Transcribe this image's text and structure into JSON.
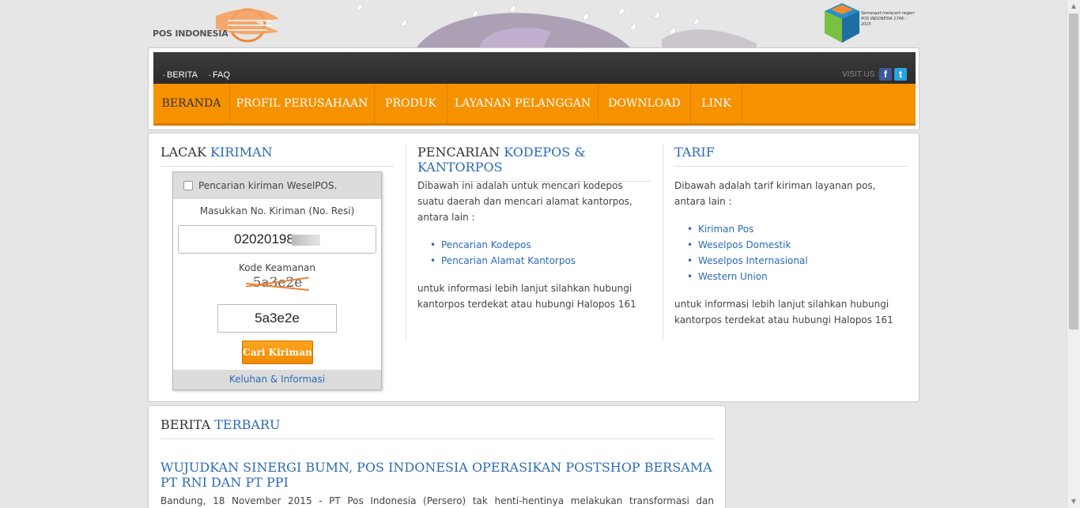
{
  "header": {
    "logo_text": "POS INDONESIA",
    "tagline": "Semangat melayani negeri POS INDONESIA 1746 - 2015"
  },
  "toplinks": {
    "berita": "BERITA",
    "faq": "FAQ",
    "visit_us": "VISIT US :"
  },
  "social": {
    "facebook": "f",
    "twitter": "t"
  },
  "menu": [
    "BERANDA",
    "PROFIL PERUSAHAAN",
    "PRODUK",
    "LAYANAN PELANGGAN",
    "DOWNLOAD",
    "LINK"
  ],
  "lacak": {
    "title_a": "LACAK",
    "title_b": "KIRIMAN",
    "checkbox_label": "Pencarian kiriman WeselPOS.",
    "resi_label": "Masukkan No. Kiriman (No. Resi)",
    "resi_value": "0202019",
    "resi_value_tail": "8",
    "kode_label": "Kode Keamanan",
    "captcha_image_text": "5a3e2e",
    "captcha_value": "5a3e2e",
    "button": "Cari Kiriman",
    "footer_link": "Keluhan & Informasi"
  },
  "kodepos": {
    "title_a": "PENCARIAN",
    "title_b": "KODEPOS & KANTORPOS",
    "intro": "Dibawah ini adalah untuk mencari kodepos suatu daerah dan mencari alamat kantorpos, antara lain :",
    "links": [
      "Pencarian Kodepos",
      "Pencarian Alamat Kantorpos"
    ],
    "footer": "untuk informasi lebih lanjut silahkan hubungi kantorpos terdekat atau hubungi Halopos 161"
  },
  "tarif": {
    "title": "TARIF",
    "intro": "Dibawah adalah tarif kiriman layanan pos, antara lain :",
    "links": [
      "Kiriman Pos",
      "Weselpos Domestik",
      "Weselpos Internasional",
      "Western Union"
    ],
    "footer": "untuk informasi lebih lanjut silahkan hubungi kantorpos terdekat atau hubungi Halopos 161"
  },
  "berita": {
    "title_a": "BERITA",
    "title_b": "TERBARU",
    "headline": "WUJUDKAN SINERGI BUMN, POS INDONESIA OPERASIKAN POSTSHOP BERSAMA PT RNI DAN PT PPI",
    "body": "Bandung, 18 November 2015 - PT Pos Indonesia (Persero) tak henti-hentinya melakukan transformasi dan"
  },
  "colors": {
    "accent_orange": "#f69200",
    "link_blue": "#2a6bb6",
    "topbar": "#333333"
  }
}
